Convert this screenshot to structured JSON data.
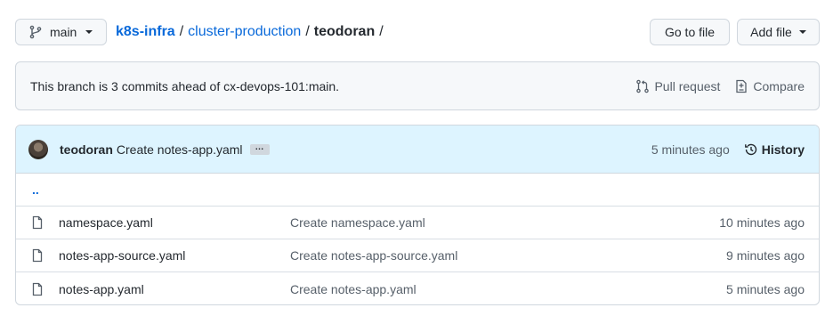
{
  "topbar": {
    "branch_label": "main",
    "breadcrumb": {
      "repo": "k8s-infra",
      "path_folder": "cluster-production",
      "current": "teodoran",
      "trailing_sep": "/"
    },
    "sep": "/",
    "goto_label": "Go to file",
    "add_label": "Add file"
  },
  "flash": {
    "message": "This branch is 3 commits ahead of cx-devops-101:main.",
    "pull_request_label": "Pull request",
    "compare_label": "Compare"
  },
  "commit": {
    "author": "teodoran",
    "message": "Create notes-app.yaml",
    "ellipsis": "…",
    "time": "5 minutes ago",
    "history_label": "History"
  },
  "parent_dir": "..",
  "files": [
    {
      "name": "namespace.yaml",
      "message": "Create namespace.yaml",
      "time": "10 minutes ago"
    },
    {
      "name": "notes-app-source.yaml",
      "message": "Create notes-app-source.yaml",
      "time": "9 minutes ago"
    },
    {
      "name": "notes-app.yaml",
      "message": "Create notes-app.yaml",
      "time": "5 minutes ago"
    }
  ],
  "icons": {
    "branch": "git-branch-icon",
    "pull_request": "git-pull-request-icon",
    "compare": "file-diff-icon",
    "history": "history-icon",
    "file": "file-icon"
  }
}
